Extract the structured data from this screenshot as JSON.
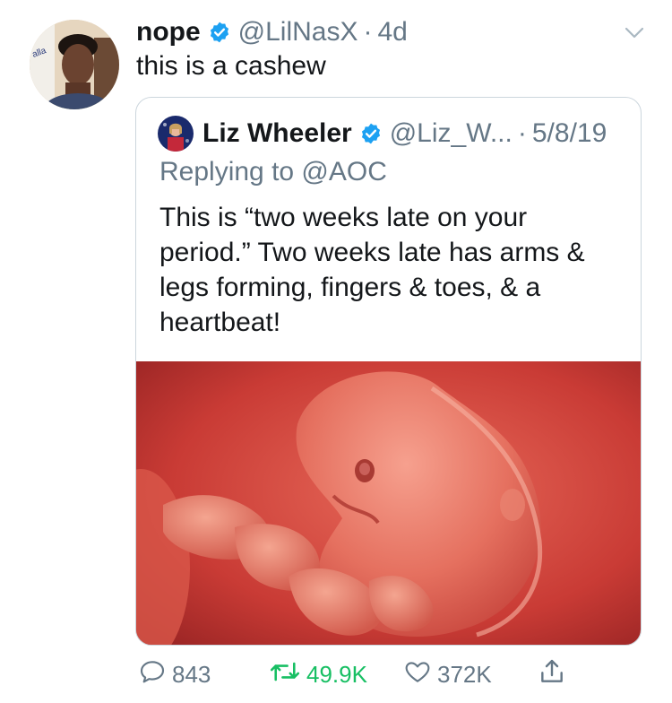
{
  "tweet": {
    "display_name": "nope",
    "handle": "@LilNasX",
    "time": "4d",
    "text": "this is a cashew"
  },
  "quoted_tweet": {
    "display_name": "Liz Wheeler",
    "handle": "@Liz_W...",
    "date": "5/8/19",
    "replying_to": "Replying to @AOC",
    "text_lines": [
      "This is “two weeks late on your",
      "period.” Two weeks late has arms &",
      "legs forming, fingers & toes, & a",
      "heartbeat!"
    ]
  },
  "actions": {
    "replies": "843",
    "retweets": "49.9K",
    "likes": "372K"
  },
  "colors": {
    "verified": "#1da1f2",
    "retweet": "#17bf63",
    "secondary_text": "#657786",
    "border": "#ccd6dd"
  },
  "icons": [
    "verified-badge-icon",
    "chevron-down-icon",
    "reply-icon",
    "retweet-icon",
    "like-icon",
    "share-icon"
  ]
}
